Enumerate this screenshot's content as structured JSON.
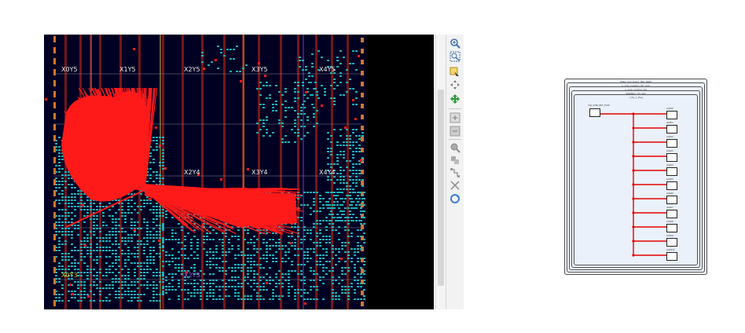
{
  "device": {
    "clock_regions_top": [
      "X0Y5",
      "X1Y5",
      "X2Y5",
      "X3Y5",
      "X4Y5"
    ],
    "clock_regions_mid": [
      "X2Y4",
      "X3Y4",
      "X4Y4"
    ],
    "clock_regions_bottom": [
      "X0Y3",
      "X2Y3"
    ],
    "colors": {
      "background": "#000022",
      "net": "#ff1a1a",
      "logic": "#1fb0b8",
      "column_highlight": "#8a1a1a"
    }
  },
  "toolbar": {
    "buttons": [
      {
        "name": "zoom-in-icon"
      },
      {
        "name": "zoom-area-icon"
      },
      {
        "name": "zoom-fit-selection-icon"
      },
      {
        "name": "zoom-fit-icon"
      },
      {
        "name": "refresh-icon"
      },
      {
        "name": "expand-icon"
      },
      {
        "name": "collapse-icon"
      },
      {
        "name": "search-icon"
      },
      {
        "name": "route-icon"
      },
      {
        "name": "unroute-icon"
      },
      {
        "name": "close-icon"
      },
      {
        "name": "sync-icon"
      }
    ]
  },
  "schematic": {
    "frames": [
      "ifdbs_rom_bram_flag_ROM",
      "u_com_control_ctrl_com",
      "u_com_control_ctrl",
      "dataReg_ctrl_adv",
      "c_flg_1_flag"
    ],
    "driver_label": "CLR_SYNC_BUF_FLOP",
    "load_labels": [
      "LOAD0",
      "LOAD1",
      "LOAD2",
      "LOAD3",
      "LOAD4",
      "LOAD5",
      "LOAD6",
      "LOAD7",
      "LOAD8",
      "LOAD9",
      "LOAD10"
    ],
    "net_color": "#e60000"
  }
}
